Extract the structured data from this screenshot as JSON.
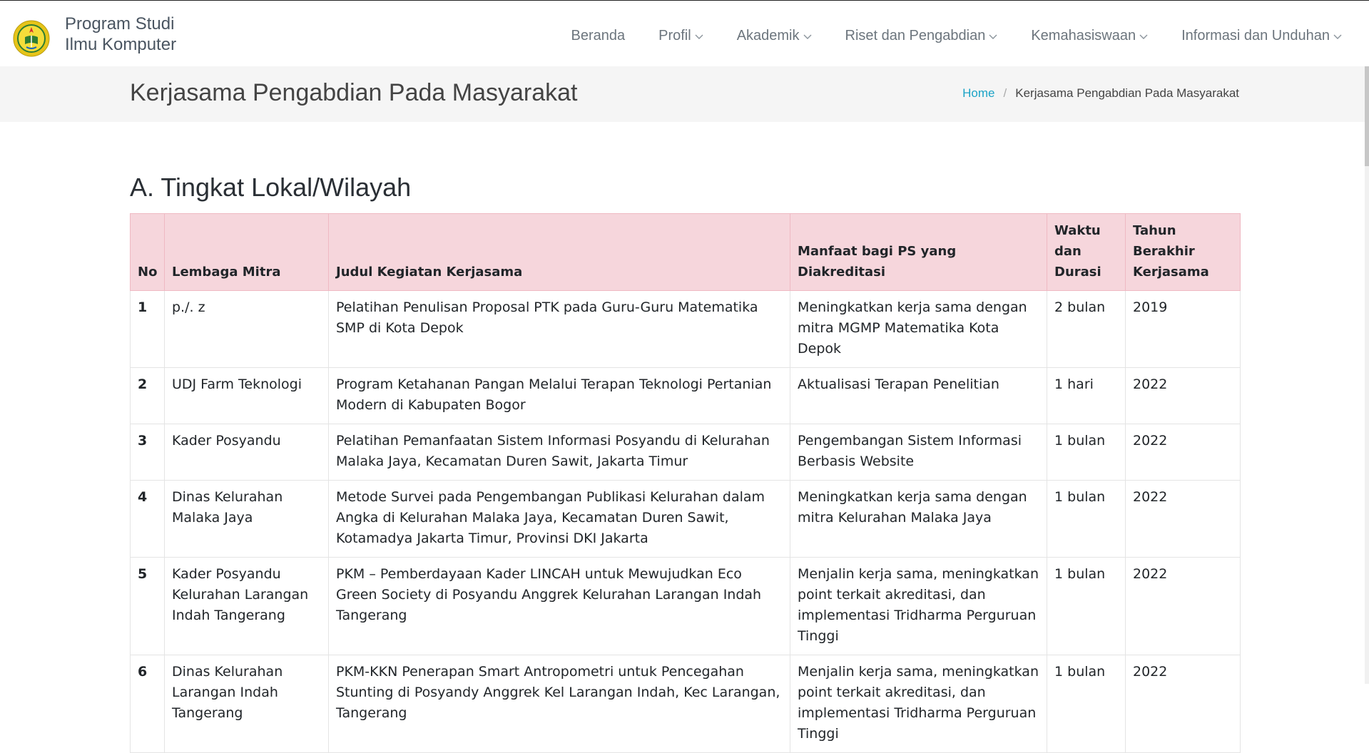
{
  "brand": {
    "line1": "Program Studi",
    "line2": "Ilmu Komputer"
  },
  "nav": [
    {
      "label": "Beranda",
      "dropdown": false
    },
    {
      "label": "Profil",
      "dropdown": true
    },
    {
      "label": "Akademik",
      "dropdown": true
    },
    {
      "label": "Riset dan Pengabdian",
      "dropdown": true
    },
    {
      "label": "Kemahasiswaan",
      "dropdown": true
    },
    {
      "label": "Informasi dan Unduhan",
      "dropdown": true
    }
  ],
  "page_title": "Kerjasama Pengabdian Pada Masyarakat",
  "breadcrumb": {
    "home": "Home",
    "separator": "/",
    "current": "Kerjasama Pengabdian Pada Masyarakat"
  },
  "section_title": "A. Tingkat Lokal/Wilayah",
  "table": {
    "headers": [
      "No",
      "Lembaga Mitra",
      "Judul Kegiatan Kerjasama",
      "Manfaat bagi PS yang Diakreditasi",
      "Waktu dan Durasi",
      "Tahun Berakhir Kerjasama"
    ],
    "rows": [
      [
        "1",
        "p./. z",
        "Pelatihan Penulisan Proposal PTK pada Guru-Guru Matematika SMP di Kota Depok",
        "Meningkatkan kerja sama dengan mitra MGMP Matematika Kota Depok",
        "2 bulan",
        "2019"
      ],
      [
        "2",
        "UDJ Farm Teknologi",
        "Program Ketahanan Pangan Melalui Terapan Teknologi Pertanian Modern di Kabupaten Bogor",
        "Aktualisasi Terapan Penelitian",
        "1 hari",
        "2022"
      ],
      [
        "3",
        "Kader Posyandu",
        "Pelatihan Pemanfaatan Sistem Informasi Posyandu di Kelurahan Malaka Jaya, Kecamatan Duren Sawit, Jakarta Timur",
        "Pengembangan Sistem Informasi Berbasis Website",
        "1 bulan",
        "2022"
      ],
      [
        "4",
        "Dinas Kelurahan Malaka Jaya",
        "Metode Survei pada Pengembangan Publikasi Kelurahan dalam Angka di Kelurahan Malaka Jaya, Kecamatan Duren Sawit, Kotamadya Jakarta Timur, Provinsi DKI Jakarta",
        "Meningkatkan kerja sama dengan mitra Kelurahan Malaka Jaya",
        "1 bulan",
        "2022"
      ],
      [
        "5",
        "Kader Posyandu Kelurahan Larangan Indah Tangerang",
        "PKM – Pemberdayaan Kader LINCAH untuk Mewujudkan Eco Green Society di Posyandu Anggrek Kelurahan Larangan Indah Tangerang",
        "Menjalin kerja sama, meningkatkan point terkait akreditasi, dan implementasi Tridharma Perguruan Tinggi",
        "1 bulan",
        "2022"
      ],
      [
        "6",
        "Dinas Kelurahan Larangan Indah Tangerang",
        "PKM-KKN Penerapan Smart Antropometri untuk Pencegahan Stunting di Posyandy Anggrek Kel Larangan Indah, Kec Larangan, Tangerang",
        "Menjalin kerja sama, meningkatkan point terkait akreditasi, dan implementasi Tridharma Perguruan Tinggi",
        "1 bulan",
        "2022"
      ]
    ]
  },
  "colors": {
    "link": "#1ba3c6",
    "header_bg": "#f6d6dc",
    "titlebar_bg": "#f5f5f5"
  },
  "icons": {
    "logo": "university-emblem-icon",
    "dropdown": "chevron-down-icon"
  }
}
